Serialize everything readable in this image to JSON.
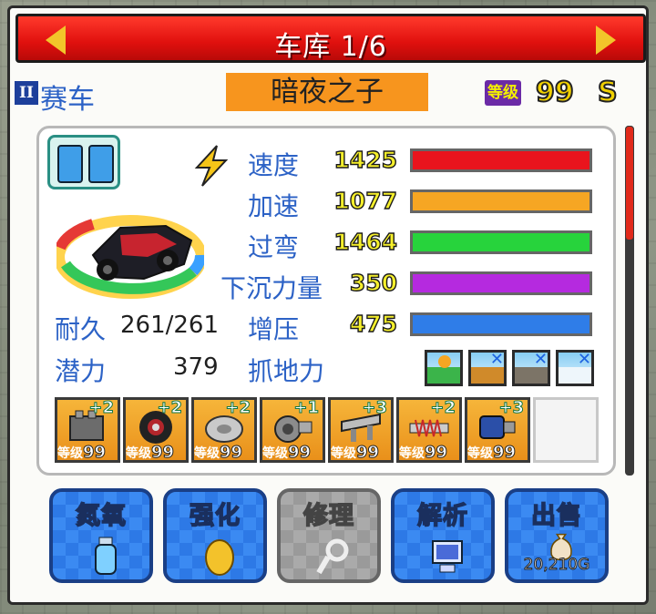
{
  "header": {
    "title": "车库 1/6",
    "prev_icon": "arrow-left-icon",
    "next_icon": "arrow-right-icon"
  },
  "car": {
    "class_badge": "II",
    "class_label": "赛车",
    "name": "暗夜之子",
    "level_badge": "等级",
    "level": "99",
    "grade": "S"
  },
  "stats": [
    {
      "label": "速度",
      "value": "1425",
      "color": "#e9141d",
      "fill": 1.0
    },
    {
      "label": "加速",
      "value": "1077",
      "color": "#f6a623",
      "fill": 1.0
    },
    {
      "label": "过弯",
      "value": "1464",
      "color": "#27d33c",
      "fill": 1.0
    },
    {
      "label": "下沉力量",
      "value": "350",
      "color": "#b52adf",
      "fill": 1.0
    },
    {
      "label": "增压",
      "value": "475",
      "color": "#2f7de8",
      "fill": 1.0
    }
  ],
  "durability": {
    "label": "耐久",
    "value": "261/261"
  },
  "potential": {
    "label": "潜力",
    "value": "379"
  },
  "grip": {
    "label": "抓地力",
    "terrains": [
      {
        "name": "road",
        "available": true
      },
      {
        "name": "dirt",
        "available": false
      },
      {
        "name": "rock",
        "available": false
      },
      {
        "name": "snow",
        "available": false
      }
    ]
  },
  "parts": [
    {
      "name": "engine",
      "plus": "+2",
      "level_prefix": "等级",
      "level": "99"
    },
    {
      "name": "tire",
      "plus": "+2",
      "level_prefix": "等级",
      "level": "99"
    },
    {
      "name": "brake",
      "plus": "+2",
      "level_prefix": "等级",
      "level": "99"
    },
    {
      "name": "turbo",
      "plus": "+1",
      "level_prefix": "等级",
      "level": "99"
    },
    {
      "name": "wing",
      "plus": "+3",
      "level_prefix": "等级",
      "level": "99"
    },
    {
      "name": "suspension",
      "plus": "+2",
      "level_prefix": "等级",
      "level": "99"
    },
    {
      "name": "booster",
      "plus": "+3",
      "level_prefix": "等级",
      "level": "99"
    }
  ],
  "actions": [
    {
      "label": "氮氧",
      "icon": "nitro-bottle-icon",
      "enabled": true
    },
    {
      "label": "强化",
      "icon": "egg-icon",
      "enabled": true
    },
    {
      "label": "修理",
      "icon": "wrench-icon",
      "enabled": false
    },
    {
      "label": "解析",
      "icon": "computer-icon",
      "enabled": true
    },
    {
      "label": "出售",
      "icon": "money-bag-icon",
      "enabled": true,
      "price": "20,210G"
    }
  ]
}
